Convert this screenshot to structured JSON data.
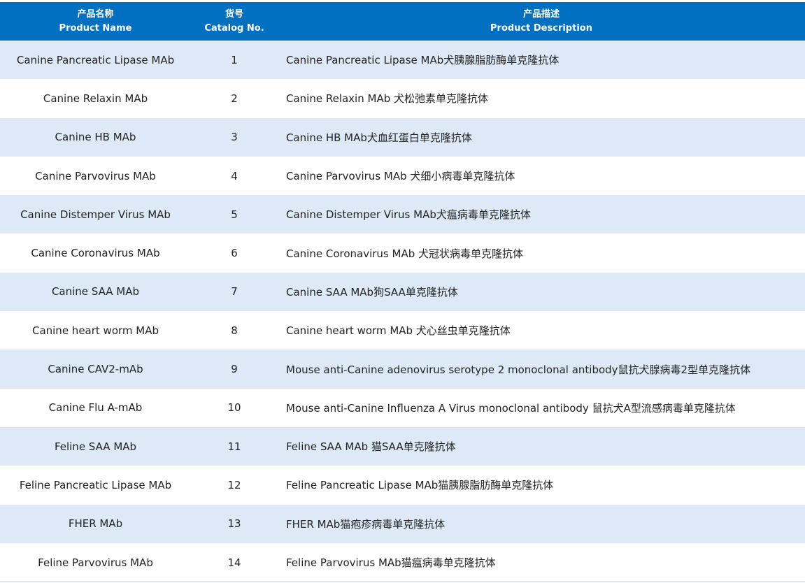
{
  "header": {
    "name_cn": "产品名称",
    "name_en": "Product Name",
    "catalog_cn": "货号",
    "catalog_en": "Catalog No.",
    "desc_cn": "产品描述",
    "desc_en": "Product Description"
  },
  "rows": [
    {
      "name": "Canine Pancreatic Lipase MAb",
      "catalog": "1",
      "desc": "Canine Pancreatic Lipase MAb犬胰腺脂肪酶单克隆抗体"
    },
    {
      "name": "Canine Relaxin MAb",
      "catalog": "2",
      "desc": "Canine Relaxin MAb 犬松弛素单克隆抗体"
    },
    {
      "name": "Canine HB MAb",
      "catalog": "3",
      "desc": "Canine HB MAb犬血红蛋白单克隆抗体"
    },
    {
      "name": "Canine Parvovirus MAb",
      "catalog": "4",
      "desc": "Canine Parvovirus MAb 犬细小病毒单克隆抗体"
    },
    {
      "name": "Canine Distemper Virus MAb",
      "catalog": "5",
      "desc": "Canine Distemper Virus MAb犬瘟病毒单克隆抗体"
    },
    {
      "name": "Canine Coronavirus MAb",
      "catalog": "6",
      "desc": "Canine Coronavirus MAb 犬冠状病毒单克隆抗体"
    },
    {
      "name": "Canine SAA MAb",
      "catalog": "7",
      "desc": "Canine SAA MAb狗SAA单克隆抗体"
    },
    {
      "name": "Canine heart worm MAb",
      "catalog": "8",
      "desc": "Canine heart worm MAb 犬心丝虫单克隆抗体"
    },
    {
      "name": "Canine CAV2-mAb",
      "catalog": "9",
      "desc": "Mouse anti-Canine adenovirus serotype 2 monoclonal antibody鼠抗犬腺病毒2型单克隆抗体"
    },
    {
      "name": "Canine Flu A-mAb",
      "catalog": "10",
      "desc": "Mouse anti-Canine Influenza A Virus monoclonal antibody 鼠抗犬A型流感病毒单克隆抗体"
    },
    {
      "name": "Feline SAA MAb",
      "catalog": "11",
      "desc": "Feline SAA MAb 猫SAA单克隆抗体"
    },
    {
      "name": "Feline Pancreatic Lipase MAb",
      "catalog": "12",
      "desc": "Feline Pancreatic Lipase MAb猫胰腺脂肪酶单克隆抗体"
    },
    {
      "name": "FHER MAb",
      "catalog": "13",
      "desc": "FHER MAb猫疱疹病毒单克隆抗体"
    },
    {
      "name": "Feline Parvovirus MAb",
      "catalog": "14",
      "desc": "Feline Parvovirus MAb猫瘟病毒单克隆抗体"
    }
  ],
  "colors": {
    "header_bg": "#0270c0",
    "stripe_bg": "#dde9f6"
  }
}
